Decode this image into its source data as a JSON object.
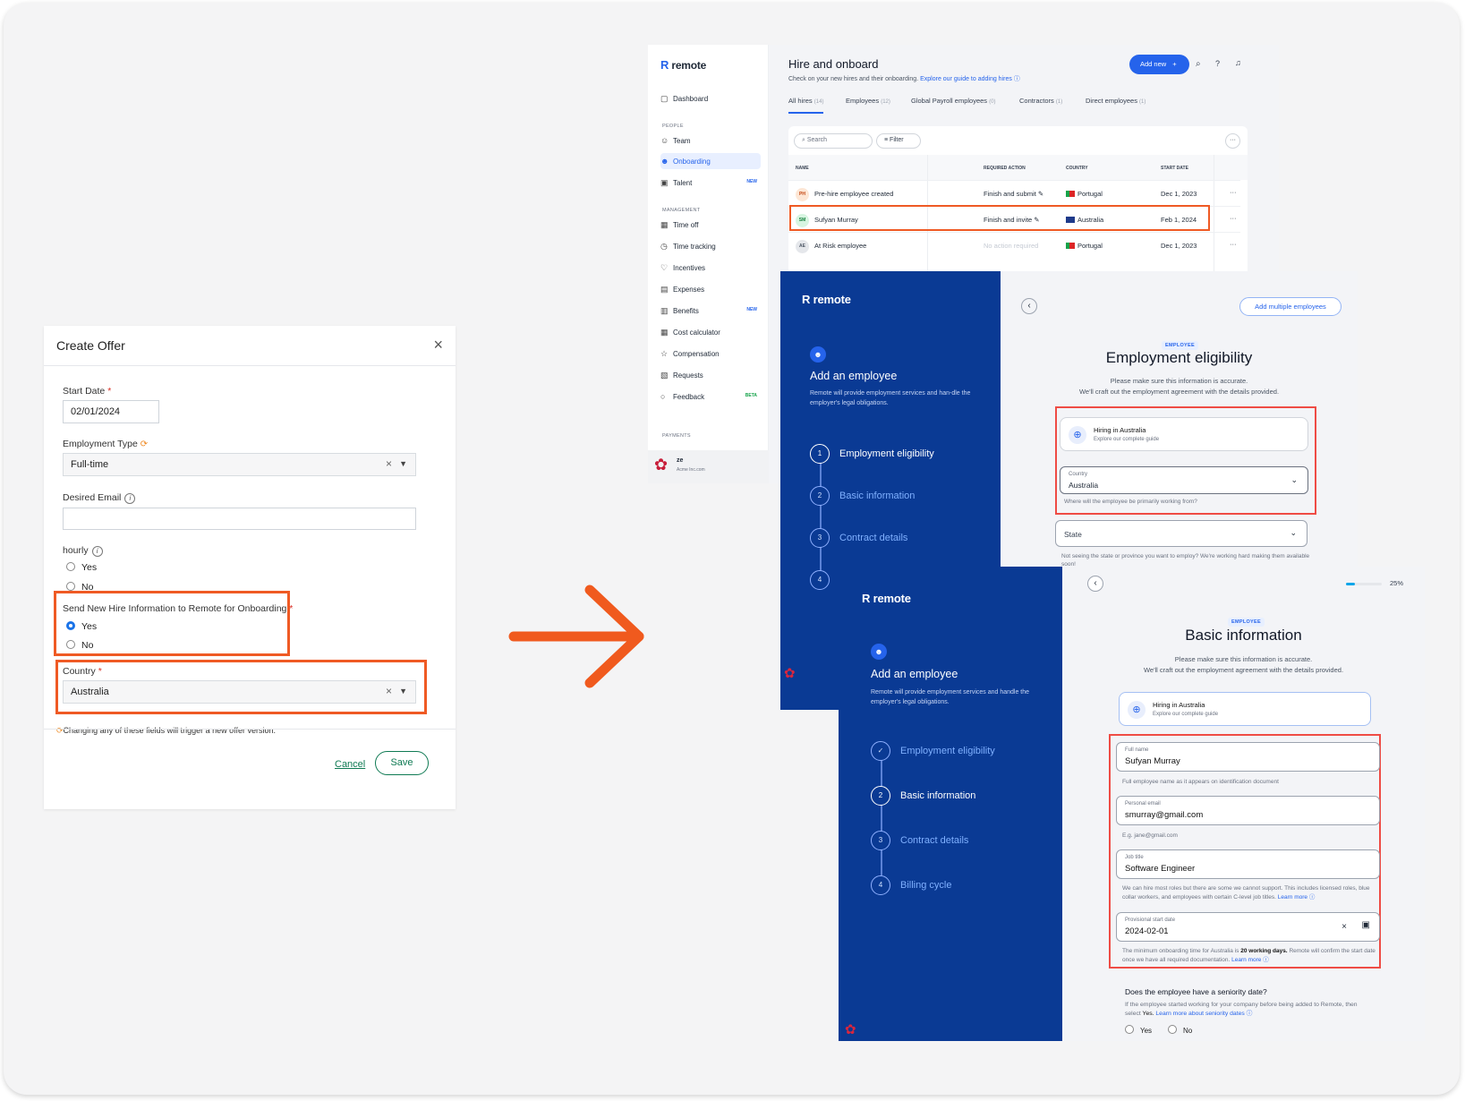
{
  "offer": {
    "title": "Create Offer",
    "close_glyph": "×",
    "start_date_label": "Start Date",
    "start_date_value": "02/01/2024",
    "employment_type_label": "Employment Type",
    "employment_type_value": "Full-time",
    "desired_email_label": "Desired Email",
    "desired_email_value": "",
    "hourly_label": "hourly",
    "hourly_yes": "Yes",
    "hourly_no": "No",
    "send_label": "Send New Hire Information to Remote for Onboarding",
    "send_yes": "Yes",
    "send_no": "No",
    "country_label": "Country",
    "country_value": "Australia",
    "required_mark": "*",
    "clear_glyph": "×",
    "warning": "Changing any of these fields will trigger a new offer version.",
    "cancel_label": "Cancel",
    "save_label": "Save"
  },
  "dashboard": {
    "brand": "remote",
    "title": "Hire and onboard",
    "subtitle": "Check on your new hires and their onboarding.",
    "guide_link": "Explore our guide to adding hires",
    "add_new": "Add new",
    "nav_top": [
      "Dashboard"
    ],
    "section_people": "PEOPLE",
    "nav_people": [
      "Team",
      "Onboarding",
      "Talent"
    ],
    "section_management": "MANAGEMENT",
    "nav_management": [
      "Time off",
      "Time tracking",
      "Incentives",
      "Expenses",
      "Benefits",
      "Cost calculator",
      "Compensation",
      "Requests",
      "Feedback"
    ],
    "section_payments": "PAYMENTS",
    "badge_new": "NEW",
    "badge_beta": "BETA",
    "user_name": "ze",
    "user_company": "Acme Inc.com",
    "tabs": [
      {
        "label": "All hires",
        "count": "(14)"
      },
      {
        "label": "Employees",
        "count": "(12)"
      },
      {
        "label": "Global Payroll employees",
        "count": "(0)"
      },
      {
        "label": "Contractors",
        "count": "(1)"
      },
      {
        "label": "Direct employees",
        "count": "(1)"
      }
    ],
    "search_placeholder": "Search",
    "filter_label": "Filter",
    "columns": [
      "NAME",
      "REQUIRED ACTION",
      "COUNTRY",
      "START DATE"
    ],
    "rows": [
      {
        "initials": "PH",
        "name": "Pre-hire employee created",
        "action": "Finish and submit",
        "country": "Portugal",
        "date": "Dec 1, 2023"
      },
      {
        "initials": "SM",
        "name": "Sufyan Murray",
        "action": "Finish and invite",
        "country": "Australia",
        "date": "Feb 1, 2024"
      },
      {
        "initials": "AE",
        "name": "At Risk employee",
        "action": "No action required",
        "country": "Portugal",
        "date": "Dec 1, 2023"
      }
    ]
  },
  "eligibility": {
    "brand": "remote",
    "panel_title": "Add an employee",
    "panel_desc": "Remote will provide employment services and han-dle the employer's legal obligations.",
    "steps": [
      "Employment eligibility",
      "Basic information",
      "Contract details"
    ],
    "step_nums": [
      "1",
      "2",
      "3",
      "4"
    ],
    "add_multiple": "Add multiple employees",
    "badge": "EMPLOYEE",
    "title": "Employment eligibility",
    "desc1": "Please make sure this information is accurate.",
    "desc2": "We'll craft out the employment agreement with the details provided.",
    "hiring_title": "Hiring in Australia",
    "hiring_sub": "Explore our complete guide",
    "country_label": "Country",
    "country_value": "Australia",
    "country_help": "Where will the employee be primarily working from?",
    "state_label": "State",
    "state_help": "Not seeing the state or province you want to employ? We're working hard making them available soon!"
  },
  "basic": {
    "brand": "remote",
    "panel_title": "Add an employee",
    "panel_desc": "Remote will provide employment services and handle the employer's legal obligations.",
    "steps": [
      "Employment eligibility",
      "Basic information",
      "Contract details",
      "Billing cycle"
    ],
    "step_nums": [
      "2",
      "3",
      "4"
    ],
    "progress_label": "25%",
    "progress": 0.25,
    "badge": "EMPLOYEE",
    "title": "Basic information",
    "desc1": "Please make sure this information is accurate.",
    "desc2": "We'll craft out the employment agreement with the details provided.",
    "hiring_title": "Hiring in Australia",
    "hiring_sub": "Explore our complete guide",
    "full_name_label": "Full name",
    "full_name_value": "Sufyan Murray",
    "full_name_help": "Full employee name as it appears on identification document",
    "email_label": "Personal email",
    "email_value": "smurray@gmail.com",
    "email_help": "E.g. jane@gmail.com",
    "job_label": "Job title",
    "job_value": "Software Engineer",
    "job_help": "We can hire most roles but there are some we cannot support. This includes licensed roles, blue collar workers, and employees with certain C-level job titles.",
    "learn_more": "Learn more",
    "start_label": "Provisional start date",
    "start_value": "2024-02-01",
    "start_help_a": "The minimum onboarding time for Australia is",
    "start_help_b": "20 working days.",
    "start_help_c": "Remote will confirm the start date once we have all required documentation.",
    "seniority_q": "Does the employee have a seniority date?",
    "seniority_help_a": "If the employee started working for your company before being added to Remote, then select",
    "seniority_help_yes": "Yes.",
    "seniority_link": "Learn more about seniority dates",
    "yes": "Yes",
    "no": "No"
  },
  "colors": {
    "accent": "#ef5a24",
    "brand_blue": "#0a3a94",
    "link_blue": "#2563eb",
    "highlight_red": "#ef4c45"
  }
}
